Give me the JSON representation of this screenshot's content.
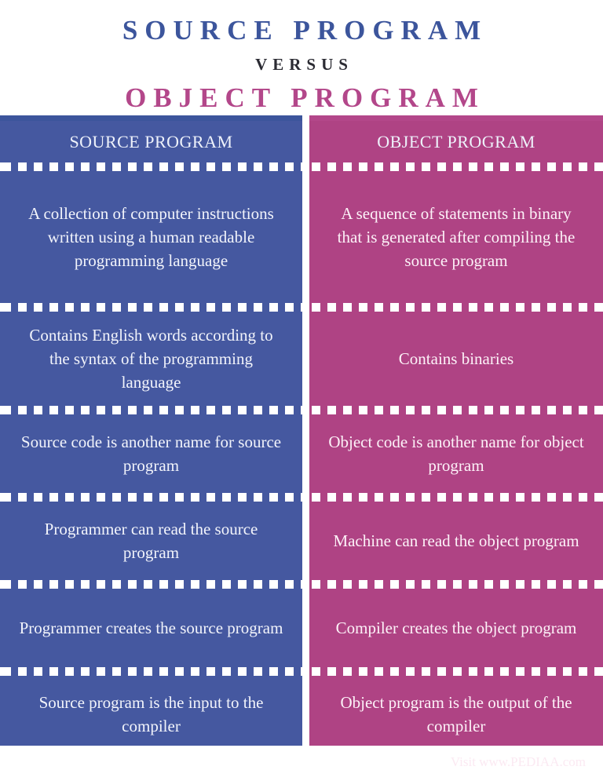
{
  "title": {
    "main": "SOURCE PROGRAM",
    "versus": "VERSUS",
    "sub": "OBJECT PROGRAM"
  },
  "colors": {
    "left_panel": "#4558a0",
    "right_panel": "#af4384",
    "left_title": "#3c559c",
    "right_title": "#b3478a",
    "versus_text": "#2b2b33",
    "dash_separator": "#ffffff"
  },
  "comparison": {
    "headers": [
      "SOURCE PROGRAM",
      "OBJECT PROGRAM"
    ],
    "rows": [
      {
        "left": "A collection of computer instructions written using a human readable programming language",
        "right": "A sequence of statements in binary that is generated after compiling the source program"
      },
      {
        "left": "Contains English words according to the syntax of the programming language",
        "right": "Contains binaries"
      },
      {
        "left": "Source code is another name for source program",
        "right": "Object code is another name for object program"
      },
      {
        "left": "Programmer can read the source program",
        "right": "Machine can read the object program"
      },
      {
        "left": "Programmer creates the source program",
        "right": "Compiler creates the object program"
      },
      {
        "left": "Source program is the input to the compiler",
        "right": "Object program is the output of the compiler"
      }
    ]
  },
  "footer": {
    "credit": "Visit www.PEDIAA.com"
  }
}
